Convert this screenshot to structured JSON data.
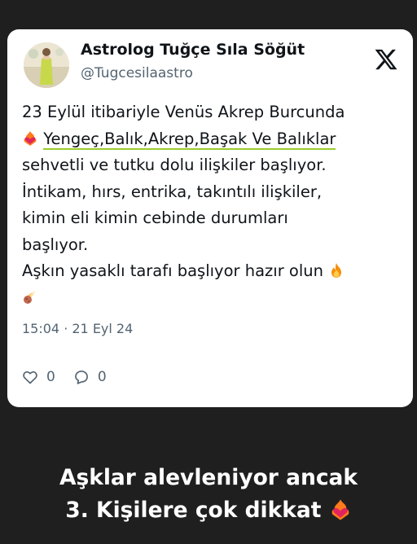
{
  "tweet": {
    "author_name": "Astrolog Tuğçe Sıla Söğüt",
    "author_handle": "@Tugcesilaastro",
    "text_lines": [
      "23 Eylül itibariyle Venüs Akrep Burcunda",
      "Yengeç,Balık,Akrep,Başak Ve Balıklar",
      "sehvetli ve tutku dolu ilişkiler başlıyor.",
      "İntikam, hırs, entrika, takıntılı ilişkiler,",
      "kimin eli kimin cebinde durumları",
      "başlıyor.",
      "Aşkın yasaklı tarafı başlıyor hazır olun"
    ],
    "timestamp": "15:04 · 21 Eyl 24",
    "like_count": "0",
    "reply_count": "0"
  },
  "caption": {
    "line1": "Aşklar alevleniyor ancak",
    "line2": "3. Kişilere çok dikkat"
  },
  "icons": {
    "brand": "x-logo-icon",
    "like": "heart-icon",
    "reply": "reply-icon",
    "emoji_heart_fire": "heart-on-fire-icon",
    "emoji_fire": "fire-icon",
    "emoji_comet": "comet-icon"
  },
  "colors": {
    "page_bg": "#1f1f1f",
    "card_bg": "#ffffff",
    "text": "#0f1419",
    "secondary": "#536471",
    "highlight_underline": "#9ccc2c"
  }
}
